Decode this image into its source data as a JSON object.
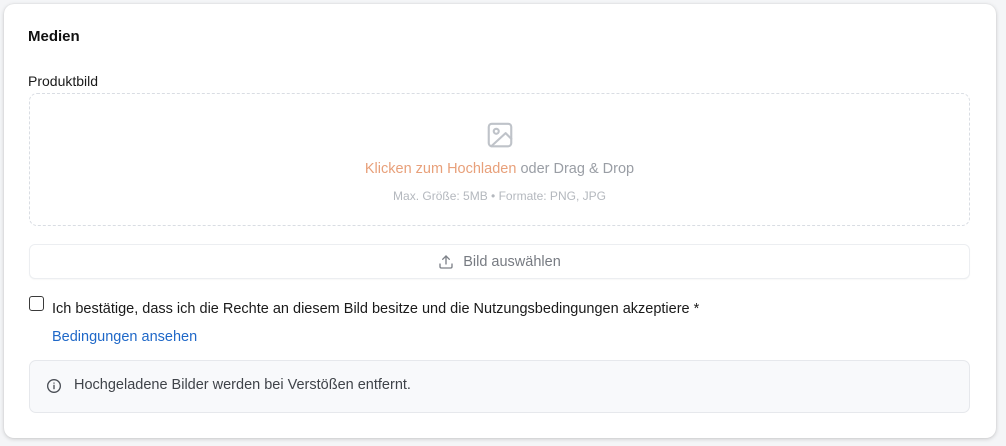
{
  "section": {
    "title": "Medien"
  },
  "upload": {
    "field_label": "Produktbild",
    "click_text": "Klicken zum Hochladen",
    "drag_text": " oder Drag & Drop",
    "hint": "Max. Größe: 5MB • Formate: PNG, JPG",
    "icon": "image-icon",
    "select_button_label": "Bild auswählen",
    "select_button_icon": "upload-icon"
  },
  "consent": {
    "checked": false,
    "label": "Ich bestätige, dass ich die Rechte an diesem Bild besitze und die Nutzungsbedingungen akzeptiere *",
    "terms_link": "Bedingungen ansehen"
  },
  "info": {
    "icon": "info-icon",
    "text": "Hochgeladene Bilder werden bei Verstößen entfernt."
  },
  "colors": {
    "accent_link": "#e8a07a",
    "terms_link": "#1f68c8",
    "info_background": "#f8f9fb"
  }
}
